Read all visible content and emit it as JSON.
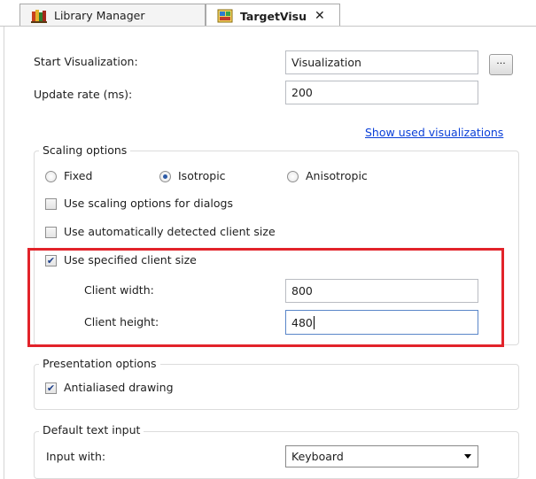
{
  "tabs": {
    "library_manager": "Library Manager",
    "target_visu": "TargetVisu"
  },
  "form": {
    "start_visualization_label": "Start Visualization:",
    "start_visualization_value": "Visualization",
    "browse_button_label": "...",
    "update_rate_label": "Update rate (ms):",
    "update_rate_value": "200",
    "show_used_link": "Show used visualizations"
  },
  "scaling": {
    "title": "Scaling options",
    "radio_fixed": "Fixed",
    "radio_isotropic": "Isotropic",
    "radio_anisotropic": "Anisotropic",
    "selected": "Isotropic",
    "dialogs_label": "Use scaling options for dialogs",
    "dialogs_checked": false,
    "auto_detect_label": "Use automatically detected client size",
    "auto_detect_checked": false,
    "specified_label": "Use specified client size",
    "specified_checked": true,
    "client_width_label": "Client width:",
    "client_width_value": "800",
    "client_height_label": "Client height:",
    "client_height_value": "480"
  },
  "presentation": {
    "title": "Presentation options",
    "antialiased_label": "Antialiased drawing",
    "antialiased_checked": true
  },
  "text_input": {
    "title": "Default text input",
    "input_with_label": "Input with:",
    "input_with_value": "Keyboard"
  },
  "colors": {
    "highlight": "#e2232a",
    "link": "#0a3fd8"
  }
}
